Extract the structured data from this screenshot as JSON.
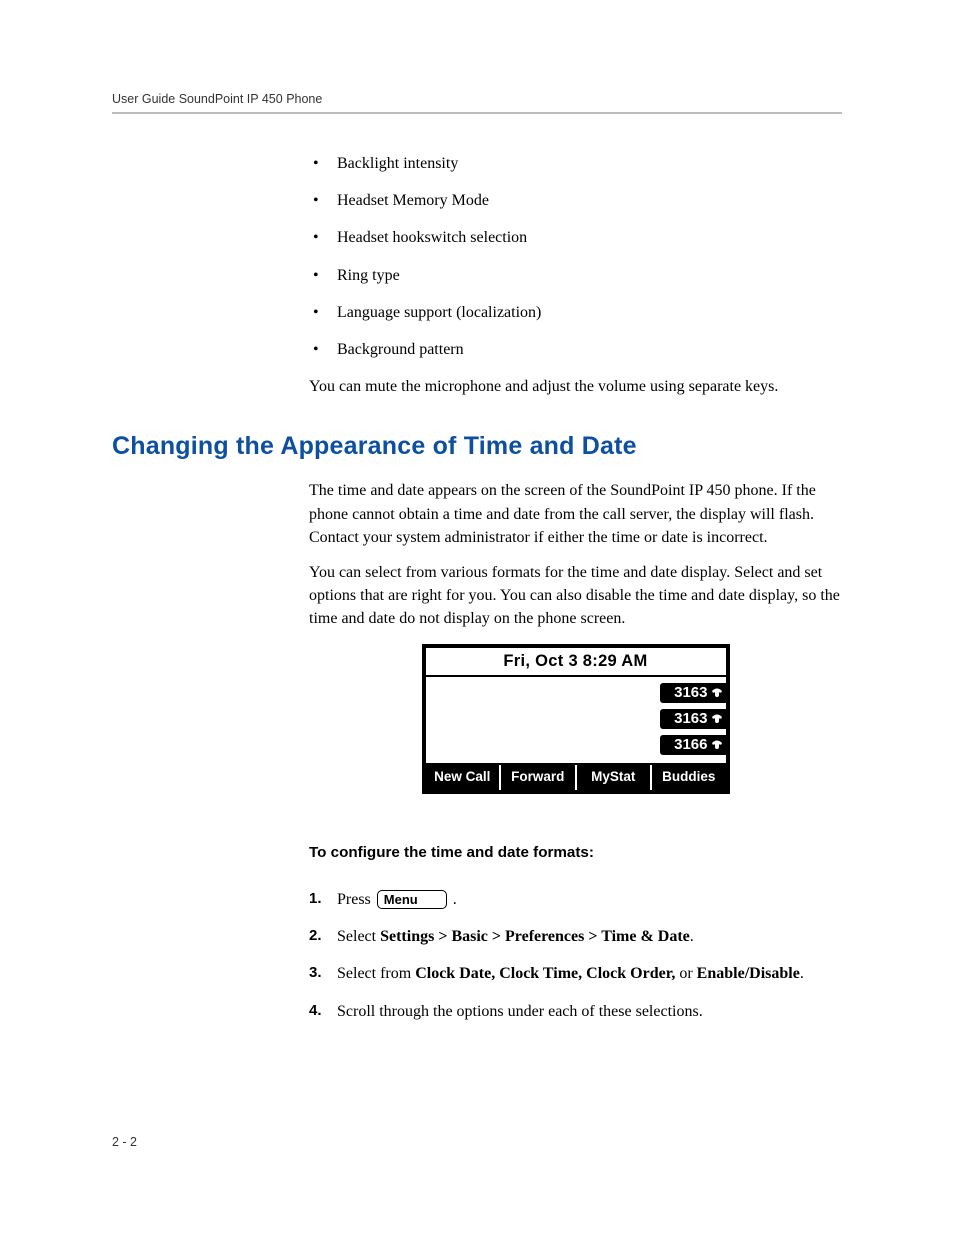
{
  "header": {
    "title": "User Guide SoundPoint IP 450 Phone"
  },
  "bullets": [
    "Backlight intensity",
    "Headset Memory Mode",
    "Headset hookswitch selection",
    "Ring type",
    "Language support (localization)",
    "Background pattern"
  ],
  "intro_para": "You can mute the microphone and adjust the volume using separate keys.",
  "section": {
    "heading": "Changing the Appearance of Time and Date",
    "para1": "The time and date appears on the screen of the SoundPoint IP 450 phone. If the phone cannot obtain a time and date from the call server, the display will flash. Contact your system administrator if either the time or date is incorrect.",
    "para2": "You can select from various formats for the time and date display. Select and set options that are right for you. You can also disable the time and date display, so the time and date do not display on the phone screen."
  },
  "phone": {
    "datetime": "Fri, Oct 3   8:29 AM",
    "lines": [
      "3163",
      "3163",
      "3166"
    ],
    "softkeys": [
      "New Call",
      "Forward",
      "MyStat",
      "Buddies"
    ]
  },
  "procedure": {
    "heading": "To configure the time and date formats:",
    "steps": {
      "s1_pre": "Press ",
      "s1_key": "Menu",
      "s1_post": " .",
      "s2_pre": "Select ",
      "s2_bold": "Settings > Basic > Preferences > Time & Date",
      "s2_post": ".",
      "s3_pre": "Select from ",
      "s3_bold": "Clock Date, Clock Time, Clock Order,",
      "s3_mid": " or ",
      "s3_bold2": "Enable/Disable",
      "s3_post": ".",
      "s4": "Scroll through the options under each of these selections."
    }
  },
  "footer": {
    "pagenum": "2 - 2"
  }
}
